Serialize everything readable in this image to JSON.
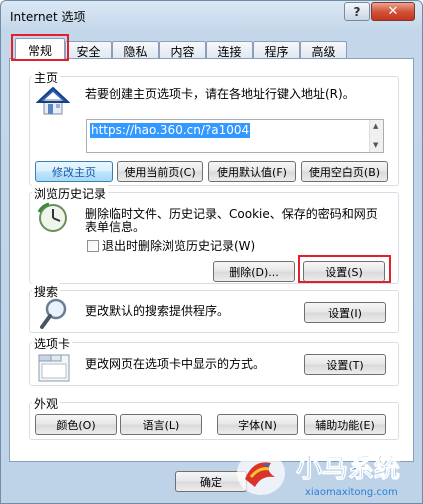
{
  "window": {
    "title": "Internet 选项",
    "help": "?",
    "close": "✕"
  },
  "tabs": [
    "常规",
    "安全",
    "隐私",
    "内容",
    "连接",
    "程序",
    "高级"
  ],
  "homepage": {
    "group_title": "主页",
    "description": "若要创建主页选项卡，请在各地址行键入地址(R)。",
    "url": "https://hao.360.cn/?a1004",
    "buttons": [
      "修改主页",
      "使用当前页(C)",
      "使用默认值(F)",
      "使用空白页(B)"
    ]
  },
  "history": {
    "group_title": "浏览历史记录",
    "description_line1": "删除临时文件、历史记录、Cookie、保存的密码和网页",
    "description_line2": "表单信息。",
    "checkbox_label": "退出时删除浏览历史记录(W)",
    "checkbox_checked": false,
    "delete_button": "删除(D)...",
    "settings_button": "设置(S)"
  },
  "search": {
    "group_title": "搜索",
    "description": "更改默认的搜索提供程序。",
    "settings_button": "设置(I)"
  },
  "tabs_section": {
    "group_title": "选项卡",
    "description": "更改网页在选项卡中显示的方式。",
    "settings_button": "设置(T)"
  },
  "appearance": {
    "group_title": "外观",
    "buttons": [
      "颜色(O)",
      "语言(L)",
      "字体(N)",
      "辅助功能(E)"
    ]
  },
  "footer": {
    "ok": "确定"
  },
  "watermark": {
    "text": "小马系统",
    "subtext": "xiaomaxitong.com"
  },
  "colors": {
    "highlight": "#e0202a",
    "selection": "#3399ff"
  }
}
